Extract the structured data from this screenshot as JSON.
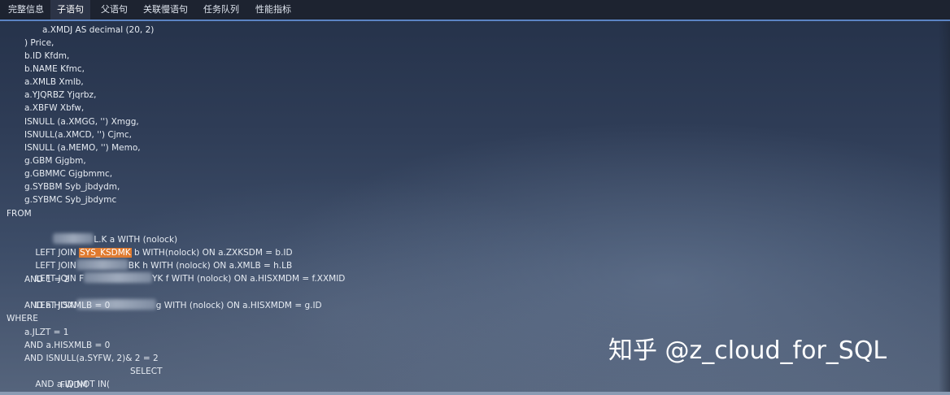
{
  "tabs": [
    {
      "id": "full",
      "label": "完整信息",
      "active": false
    },
    {
      "id": "child",
      "label": "子语句",
      "active": true
    },
    {
      "id": "parent",
      "label": "父语句",
      "active": false
    },
    {
      "id": "related",
      "label": "关联慢语句",
      "active": false
    },
    {
      "id": "queue",
      "label": "任务队列",
      "active": false
    },
    {
      "id": "perf",
      "label": "性能指标",
      "active": false
    }
  ],
  "sql": {
    "l01": "a.XMDJ AS decimal (20, 2)",
    "l02": ") Price,",
    "l03": "b.ID Kfdm,",
    "l04": "b.NAME Kfmc,",
    "l05": "a.XMLB Xmlb,",
    "l06": "a.YJQRBZ Yjqrbz,",
    "l07": "a.XBFW Xbfw,",
    "l08": "ISNULL (a.XMGG, '') Xmgg,",
    "l09": "ISNULL(a.XMCD, '') Cjmc,",
    "l10": "ISNULL (a.MEMO, '') Memo,",
    "l11": "g.GBM Gjgbm,",
    "l12": "g.GBMMC Gjgbmmc,",
    "l13": "g.SYBBM Syb_jbdydm,",
    "l14": "g.SYBMC Syb_jbdymc",
    "l15": "FROM",
    "l16b": "L.K a WITH (nolock)",
    "l17a": "LEFT JOIN ",
    "l17hl": "SYS_KSDMK",
    "l17b": " b WITH(nolock) ON a.ZXKSDM = b.ID",
    "l18a": "LEFT JOIN",
    "l18b": "BK h WITH (nolock) ON a.XMLB = h.LB",
    "l19a": "LEFT JOIN F",
    "l19b": "YK f WITH (nolock) ON a.HISXMDM = f.XXMID",
    "l20": "AND 1 = 2",
    "l21a": "LEFT JOIN",
    "l21b": "g WITH (nolock) ON a.HISXMDM = g.ID",
    "l22": "AND a.HISXMLB = 0",
    "l23": "WHERE",
    "l24": "a.JLZT = 1",
    "l25": "AND a.HISXMLB = 0",
    "l26": "AND ISNULL(a.SYFW, 2)& 2 = 2",
    "l27a": "AND a.ID NOT IN(",
    "l27b": "SELECT",
    "l28": "FWDM"
  },
  "watermark": "知乎 @z_cloud_for_SQL"
}
